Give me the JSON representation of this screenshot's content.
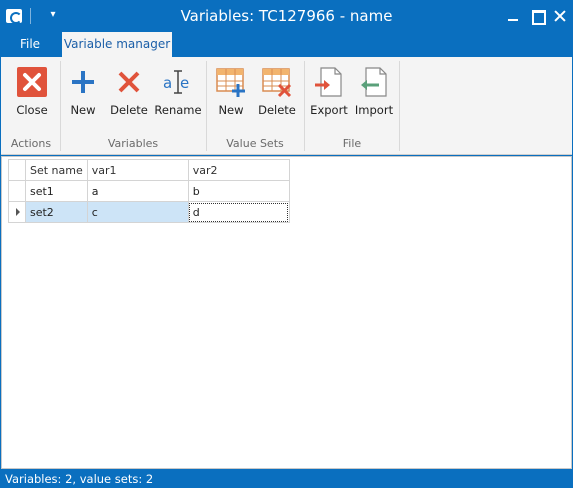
{
  "window": {
    "title": "Variables: TC127966 - name",
    "quick_access_icon": "dropdown-arrow-icon"
  },
  "tabs": [
    {
      "label": "File"
    },
    {
      "label": "Variable manager"
    }
  ],
  "ribbon": {
    "groups": [
      {
        "label": "Actions",
        "buttons": [
          {
            "label": "Close",
            "icon": "close-x-icon"
          }
        ]
      },
      {
        "label": "Variables",
        "buttons": [
          {
            "label": "New",
            "icon": "plus-icon"
          },
          {
            "label": "Delete",
            "icon": "red-x-icon"
          },
          {
            "label": "Rename",
            "icon": "rename-icon"
          }
        ]
      },
      {
        "label": "Value Sets",
        "buttons": [
          {
            "label": "New",
            "icon": "table-add-icon"
          },
          {
            "label": "Delete",
            "icon": "table-delete-icon"
          }
        ]
      },
      {
        "label": "File",
        "buttons": [
          {
            "label": "Export",
            "icon": "export-icon"
          },
          {
            "label": "Import",
            "icon": "import-icon"
          }
        ]
      }
    ]
  },
  "grid": {
    "columns": [
      "Set name",
      "var1",
      "var2"
    ],
    "rows": [
      {
        "name": "set1",
        "var1": "a",
        "var2": "b"
      },
      {
        "name": "set2",
        "var1": "c",
        "var2": "d"
      }
    ],
    "selected_row": 1
  },
  "status": {
    "text": "Variables: 2, value sets: 2"
  },
  "colors": {
    "accent": "#0a6fbf",
    "ribbon_bg": "#f4f4f4",
    "selection": "#cde4f7",
    "icon_red": "#e0533b",
    "icon_blue": "#2a74c4"
  }
}
